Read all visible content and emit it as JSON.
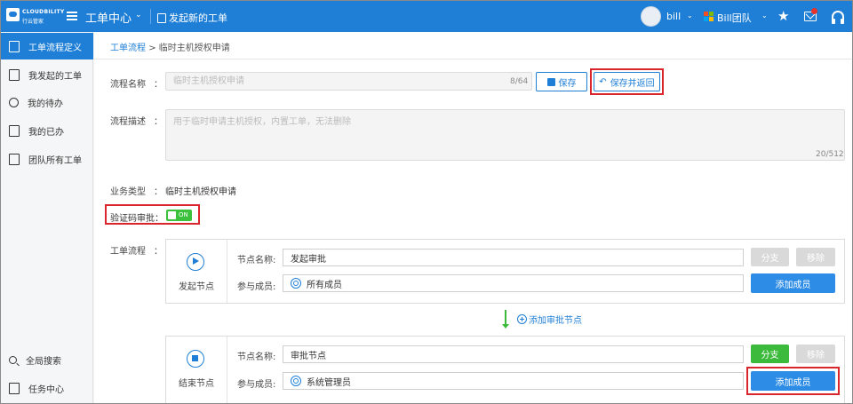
{
  "header": {
    "logo_top": "CLOUDBILITY",
    "logo_bottom": "行云管家",
    "app_title": "工单中心",
    "new_ticket": "发起新的工单",
    "user": "bill",
    "team": "Bill团队",
    "colors": {
      "bar": "#1f7fd6"
    }
  },
  "sidebar": {
    "items": [
      {
        "label": "工单流程定义",
        "icon": "clipboard-icon"
      },
      {
        "label": "我发起的工单",
        "icon": "document-clock-icon"
      },
      {
        "label": "我的待办",
        "icon": "clock-icon"
      },
      {
        "label": "我的已办",
        "icon": "checklist-icon"
      },
      {
        "label": "团队所有工单",
        "icon": "folder-icon"
      }
    ],
    "bottom": [
      {
        "label": "全局搜索",
        "icon": "search-icon"
      },
      {
        "label": "任务中心",
        "icon": "task-icon"
      }
    ]
  },
  "breadcrumb": {
    "parent": "工单流程",
    "separator": ">",
    "current": "临时主机授权申请"
  },
  "form": {
    "name_label": "流程名称",
    "name_value": "临时主机授权申请",
    "name_counter": "8/64",
    "save": "保存",
    "save_return": "保存并返回",
    "desc_label": "流程描述",
    "desc_value": "用于临时申请主机授权，内置工单，无法删除",
    "desc_counter": "20/512",
    "type_label": "业务类型",
    "type_value": "临时主机授权申请",
    "captcha_label": "验证码审批：",
    "captcha_toggle": "ON",
    "flow_label": "工单流程",
    "colon": "："
  },
  "flow": {
    "start": {
      "type": "发起节点",
      "name_label": "节点名称:",
      "name_value": "发起审批",
      "member_label": "参与成员:",
      "member_value": "所有成员",
      "branch": "分支",
      "remove": "移除",
      "add_member": "添加成员"
    },
    "add_node": "添加审批节点",
    "end": {
      "type": "结束节点",
      "name_label": "节点名称:",
      "name_value": "审批节点",
      "member_label": "参与成员:",
      "member_value": "系统管理员",
      "branch": "分支",
      "remove": "移除",
      "add_member": "添加成员"
    }
  }
}
